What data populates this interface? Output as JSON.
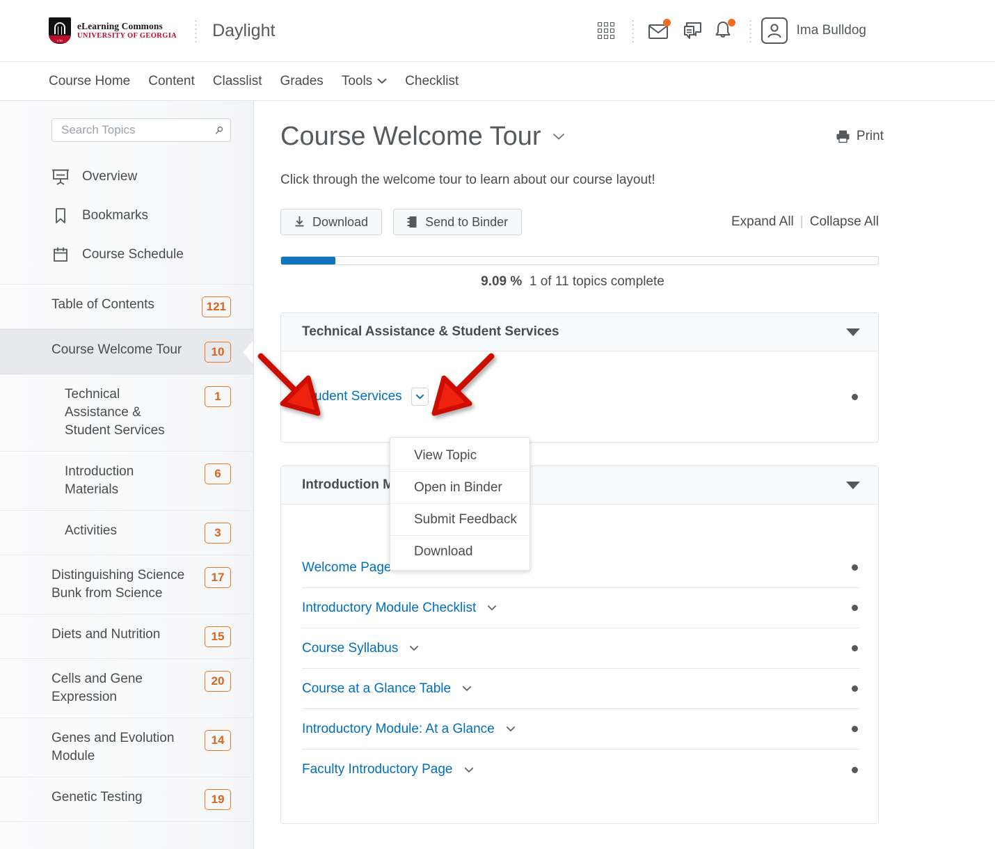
{
  "header": {
    "logo_line1": "eLearning Commons",
    "logo_line2": "UNIVERSITY OF GEORGIA",
    "logo_year": "1785",
    "product_title": "Daylight",
    "icons": {
      "waffle": "apps-grid-icon",
      "mail": "envelope-icon",
      "chat": "chat-bubble-icon",
      "alerts": "bell-icon",
      "avatar": "user-avatar-icon"
    },
    "user_name": "Ima Bulldog",
    "accent_badge_color": "#f26c21"
  },
  "nav": {
    "items": [
      {
        "label": "Course Home",
        "has_caret": false
      },
      {
        "label": "Content",
        "has_caret": false
      },
      {
        "label": "Classlist",
        "has_caret": false
      },
      {
        "label": "Grades",
        "has_caret": false
      },
      {
        "label": "Tools",
        "has_caret": true
      },
      {
        "label": "Checklist",
        "has_caret": false
      }
    ]
  },
  "sidebar": {
    "search": {
      "value": "",
      "placeholder": "Search Topics",
      "icon": "search-icon"
    },
    "quick_links": [
      {
        "label": "Overview",
        "icon": "presentation-screen-icon"
      },
      {
        "label": "Bookmarks",
        "icon": "bookmark-icon"
      },
      {
        "label": "Course Schedule",
        "icon": "calendar-icon"
      }
    ],
    "toc": [
      {
        "label": "Table of Contents",
        "count": "121",
        "sub": false,
        "active": false
      },
      {
        "label": "Course Welcome Tour",
        "count": "10",
        "sub": false,
        "active": true
      },
      {
        "label": "Technical Assistance & Student Services",
        "count": "1",
        "sub": true,
        "active": false
      },
      {
        "label": "Introduction Materials",
        "count": "6",
        "sub": true,
        "active": false
      },
      {
        "label": "Activities",
        "count": "3",
        "sub": true,
        "active": false
      },
      {
        "label": "Distinguishing Science Bunk from Science",
        "count": "17",
        "sub": false,
        "active": false
      },
      {
        "label": "Diets and Nutrition",
        "count": "15",
        "sub": false,
        "active": false
      },
      {
        "label": "Cells and Gene Expression",
        "count": "20",
        "sub": false,
        "active": false
      },
      {
        "label": "Genes and Evolution Module",
        "count": "14",
        "sub": false,
        "active": false
      },
      {
        "label": "Genetic Testing",
        "count": "19",
        "sub": false,
        "active": false
      }
    ],
    "badge_color": "#e87722"
  },
  "main": {
    "page_title": "Course Welcome Tour",
    "title_caret": "⌄",
    "print_label": "Print",
    "print_icon": "printer-icon",
    "subtitle": "Click through the welcome tour to learn about our course layout!",
    "buttons": [
      {
        "label": "Download",
        "icon": "download-arrow-icon"
      },
      {
        "label": "Send to Binder",
        "icon": "binder-icon"
      }
    ],
    "expand_all": "Expand All",
    "separator": "|",
    "collapse_all": "Collapse All",
    "progress": {
      "percent_text": "9.09 %",
      "percent_value": 9.09,
      "status_text": "1 of 11 topics complete",
      "fill_color": "#1073bd"
    },
    "modules": [
      {
        "title": "Technical Assistance & Student Services",
        "collapse_icon": "triangle-down-icon",
        "topics": [
          {
            "label": "Student Services",
            "menu_open": true,
            "completed": true
          }
        ]
      },
      {
        "title": "Introduction Materials",
        "collapse_icon": "triangle-down-icon",
        "topics": [
          {
            "label": "Welcome Page",
            "menu_open": false,
            "completed": true
          },
          {
            "label": "Introductory Module Checklist",
            "menu_open": false,
            "completed": true
          },
          {
            "label": "Course Syllabus",
            "menu_open": false,
            "completed": true
          },
          {
            "label": "Course at a Glance Table",
            "menu_open": false,
            "completed": true
          },
          {
            "label": "Introductory Module: At a Glance",
            "menu_open": false,
            "completed": true
          },
          {
            "label": "Faculty Introductory Page",
            "menu_open": false,
            "completed": true
          }
        ]
      }
    ],
    "context_menu": {
      "items": [
        {
          "label": "View Topic"
        },
        {
          "label": "Open in Binder"
        },
        {
          "label": "Submit Feedback"
        },
        {
          "label": "Download"
        }
      ]
    },
    "annotations": {
      "arrow_color": "#ee2211",
      "arrows": [
        {
          "name": "arrow-to-topic-link"
        },
        {
          "name": "arrow-to-topic-menu-button"
        }
      ]
    },
    "link_color": "#006fbf"
  }
}
